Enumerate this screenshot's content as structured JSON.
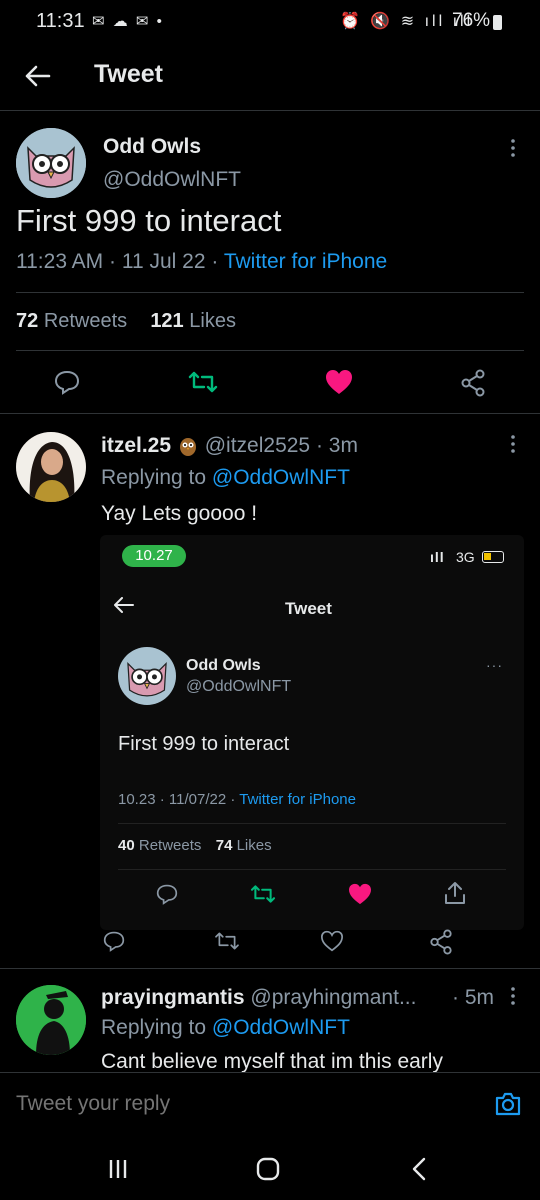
{
  "status_bar": {
    "time": "11:31",
    "battery": "76%"
  },
  "header": {
    "title": "Tweet"
  },
  "main_tweet": {
    "author_name": "Odd Owls",
    "author_handle": "@OddOwlNFT",
    "text": "First 999 to interact",
    "time": "11:23 AM",
    "date": "11 Jul 22",
    "source": "Twitter for iPhone",
    "retweets_count": "72",
    "retweets_label": "Retweets",
    "likes_count": "121",
    "likes_label": "Likes"
  },
  "reply1": {
    "author_name": "itzel.25",
    "author_handle": "@itzel2525",
    "age": "3m",
    "replying_label": "Replying to",
    "replying_handle": "@OddOwlNFT",
    "text": "Yay Lets goooo !",
    "embedded": {
      "time_pill": "10.27",
      "network": "3G",
      "title": "Tweet",
      "author_name": "Odd Owls",
      "author_handle": "@OddOwlNFT",
      "text": "First 999 to interact",
      "time": "10.23",
      "date": "11/07/22",
      "source": "Twitter for iPhone",
      "retweets_count": "40",
      "retweets_label": "Retweets",
      "likes_count": "74",
      "likes_label": "Likes"
    }
  },
  "reply2": {
    "author_name": "prayingmantis",
    "author_handle": "@prayhingmant...",
    "age": "5m",
    "replying_label": "Replying to",
    "replying_handle": "@OddOwlNFT",
    "text": "Cant believe myself that im this early"
  },
  "reply_input": {
    "placeholder": "Tweet your reply"
  },
  "colors": {
    "accent": "#1d9bf0",
    "like": "#f91880",
    "retweet": "#00ba7c",
    "background": "#000000"
  }
}
